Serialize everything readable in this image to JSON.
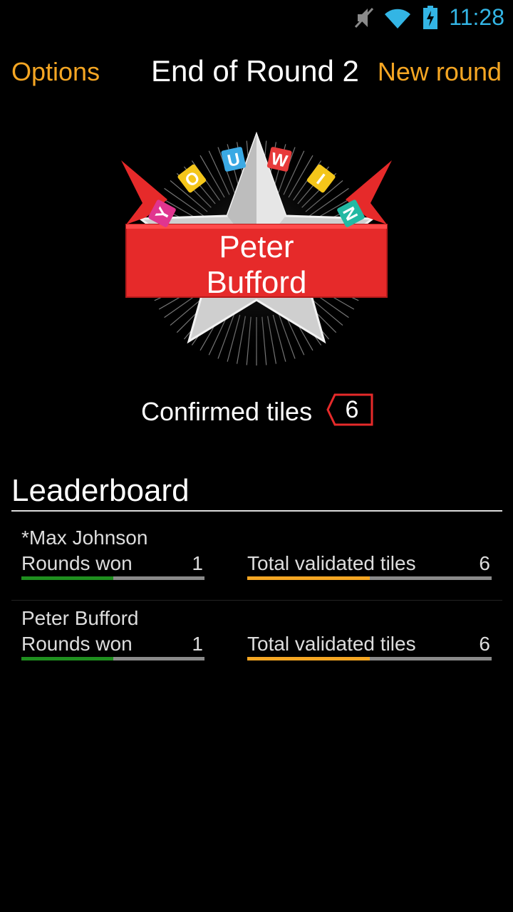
{
  "status": {
    "time": "11:28"
  },
  "header": {
    "options_label": "Options",
    "title": "End of Round 2",
    "new_round_label": "New round"
  },
  "winner": {
    "badge_text": [
      "Y",
      "O",
      "U",
      "W",
      "I",
      "N"
    ],
    "badge_colors": [
      "#e0358f",
      "#f4c61a",
      "#3aa9e4",
      "#e83b3b",
      "#f4c61a",
      "#23b9a3"
    ],
    "name_line1": "Peter",
    "name_line2": "Bufford"
  },
  "confirmed": {
    "label": "Confirmed tiles",
    "value": "6"
  },
  "leaderboard": {
    "title": "Leaderboard",
    "players": [
      {
        "name": "*Max Johnson",
        "rounds_label": "Rounds won",
        "rounds_value": "1",
        "rounds_fraction": 0.5,
        "tiles_label": "Total validated tiles",
        "tiles_value": "6",
        "tiles_fraction": 0.5
      },
      {
        "name": "Peter Bufford",
        "rounds_label": "Rounds won",
        "rounds_value": "1",
        "rounds_fraction": 0.5,
        "tiles_label": "Total validated tiles",
        "tiles_value": "6",
        "tiles_fraction": 0.5
      }
    ]
  },
  "colors": {
    "accent": "#f5a623",
    "status": "#33b5e5",
    "rounds_bar": "#1f8f1f",
    "tiles_bar": "#f5a623",
    "ribbon": "#e62a2a"
  }
}
